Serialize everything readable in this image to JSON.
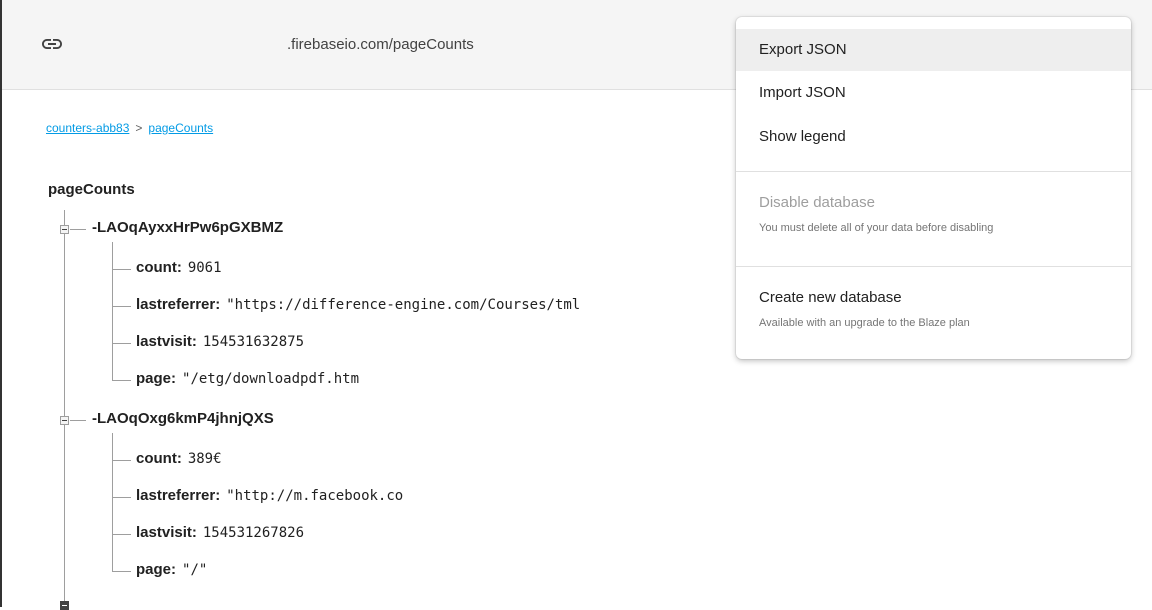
{
  "urlbar": {
    "icon": "link-icon",
    "url": ".firebaseio.com/pageCounts"
  },
  "breadcrumb": {
    "root": "counters-abb83",
    "separator": ">",
    "current": "pageCounts"
  },
  "tree": {
    "root": "pageCounts",
    "nodes": [
      {
        "key": "-LAOqAyxxHrPw6pGXBMZ",
        "fields": [
          {
            "k": "count:",
            "v": "9061"
          },
          {
            "k": "lastreferrer:",
            "v": "\"https://difference-engine.com/Courses/tml"
          },
          {
            "k": "lastvisit:",
            "v": "154531632875"
          },
          {
            "k": "page:",
            "v": "\"/etg/downloadpdf.htm"
          }
        ]
      },
      {
        "key": "-LAOqOxg6kmP4jhnjQXS",
        "fields": [
          {
            "k": "count:",
            "v": "389€"
          },
          {
            "k": "lastreferrer:",
            "v": "\"http://m.facebook.co"
          },
          {
            "k": "lastvisit:",
            "v": "154531267826"
          },
          {
            "k": "page:",
            "v": "\"/\""
          }
        ]
      }
    ]
  },
  "menu": {
    "export_json": "Export JSON",
    "import_json": "Import JSON",
    "show_legend": "Show legend",
    "disable_database": "Disable database",
    "disable_note": "You must delete all of your data before disabling",
    "create_database": "Create new database",
    "create_note": "Available with an upgrade to the Blaze plan"
  }
}
